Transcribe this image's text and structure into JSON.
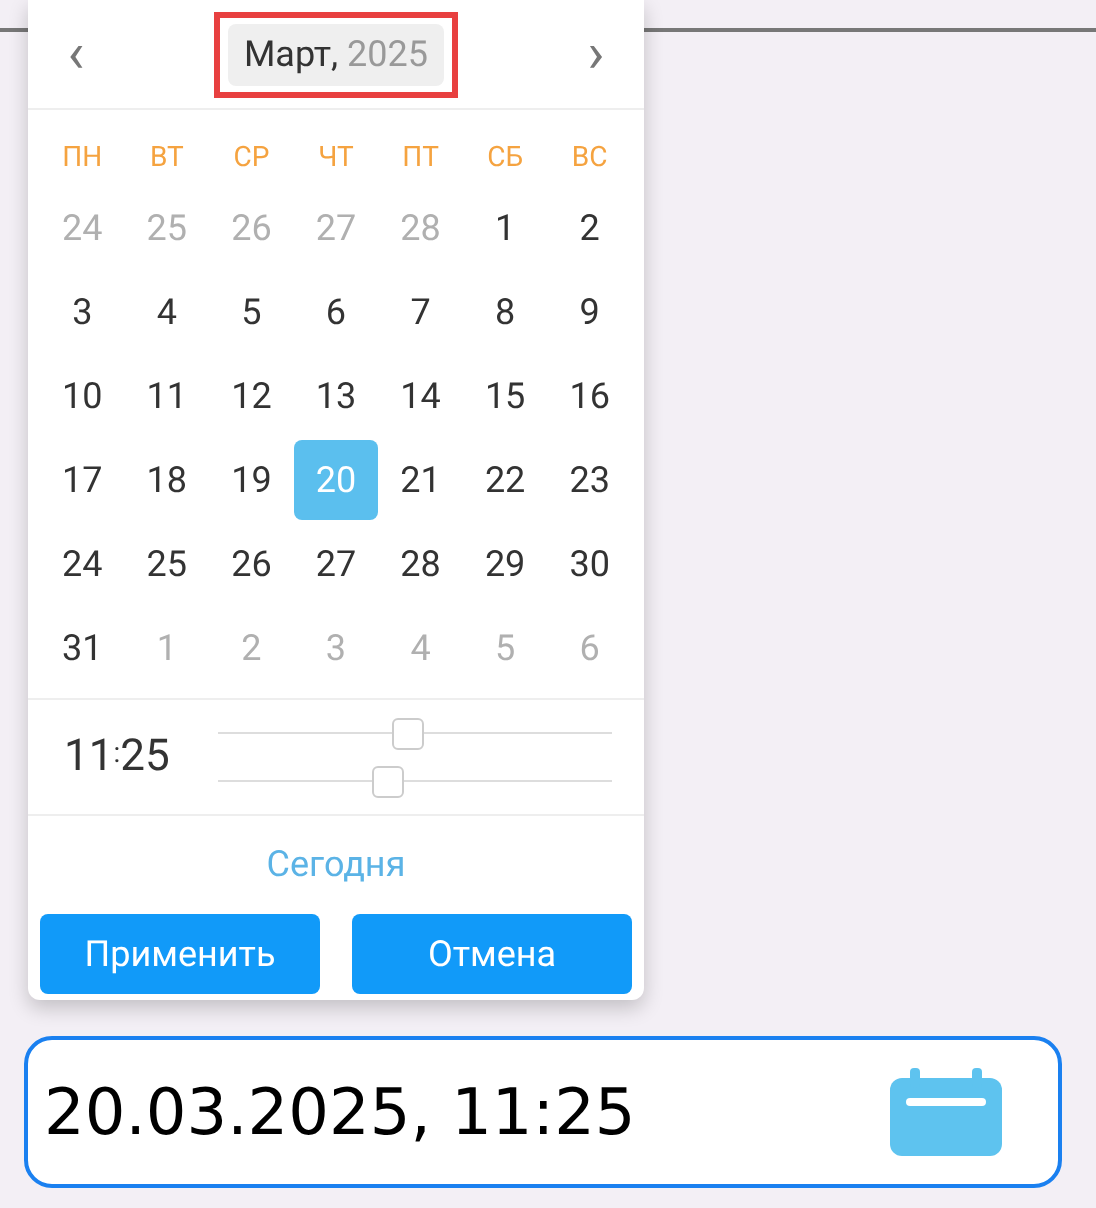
{
  "header": {
    "month": "Март,",
    "year": "2025",
    "highlighted": true,
    "prev": "‹",
    "next": "›"
  },
  "weekdays": [
    "ПН",
    "ВТ",
    "СР",
    "ЧТ",
    "ПТ",
    "СБ",
    "ВС"
  ],
  "weeks": [
    [
      {
        "day": "24",
        "muted": true,
        "selected": false
      },
      {
        "day": "25",
        "muted": true,
        "selected": false
      },
      {
        "day": "26",
        "muted": true,
        "selected": false
      },
      {
        "day": "27",
        "muted": true,
        "selected": false
      },
      {
        "day": "28",
        "muted": true,
        "selected": false
      },
      {
        "day": "1",
        "muted": false,
        "selected": false
      },
      {
        "day": "2",
        "muted": false,
        "selected": false
      }
    ],
    [
      {
        "day": "3",
        "muted": false,
        "selected": false
      },
      {
        "day": "4",
        "muted": false,
        "selected": false
      },
      {
        "day": "5",
        "muted": false,
        "selected": false
      },
      {
        "day": "6",
        "muted": false,
        "selected": false
      },
      {
        "day": "7",
        "muted": false,
        "selected": false
      },
      {
        "day": "8",
        "muted": false,
        "selected": false
      },
      {
        "day": "9",
        "muted": false,
        "selected": false
      }
    ],
    [
      {
        "day": "10",
        "muted": false,
        "selected": false
      },
      {
        "day": "11",
        "muted": false,
        "selected": false
      },
      {
        "day": "12",
        "muted": false,
        "selected": false
      },
      {
        "day": "13",
        "muted": false,
        "selected": false
      },
      {
        "day": "14",
        "muted": false,
        "selected": false
      },
      {
        "day": "15",
        "muted": false,
        "selected": false
      },
      {
        "day": "16",
        "muted": false,
        "selected": false
      }
    ],
    [
      {
        "day": "17",
        "muted": false,
        "selected": false
      },
      {
        "day": "18",
        "muted": false,
        "selected": false
      },
      {
        "day": "19",
        "muted": false,
        "selected": false
      },
      {
        "day": "20",
        "muted": false,
        "selected": true
      },
      {
        "day": "21",
        "muted": false,
        "selected": false
      },
      {
        "day": "22",
        "muted": false,
        "selected": false
      },
      {
        "day": "23",
        "muted": false,
        "selected": false
      }
    ],
    [
      {
        "day": "24",
        "muted": false,
        "selected": false
      },
      {
        "day": "25",
        "muted": false,
        "selected": false
      },
      {
        "day": "26",
        "muted": false,
        "selected": false
      },
      {
        "day": "27",
        "muted": false,
        "selected": false
      },
      {
        "day": "28",
        "muted": false,
        "selected": false
      },
      {
        "day": "29",
        "muted": false,
        "selected": false
      },
      {
        "day": "30",
        "muted": false,
        "selected": false
      }
    ],
    [
      {
        "day": "31",
        "muted": false,
        "selected": false
      },
      {
        "day": "1",
        "muted": true,
        "selected": false
      },
      {
        "day": "2",
        "muted": true,
        "selected": false
      },
      {
        "day": "3",
        "muted": true,
        "selected": false
      },
      {
        "day": "4",
        "muted": true,
        "selected": false
      },
      {
        "day": "5",
        "muted": true,
        "selected": false
      },
      {
        "day": "6",
        "muted": true,
        "selected": false
      }
    ]
  ],
  "time": {
    "hours": "11",
    "separator": ":",
    "minutes": "25",
    "sliders": [
      {
        "level": 0.48
      },
      {
        "level": 0.43
      }
    ]
  },
  "today": "Сегодня",
  "buttons": [
    "Применить",
    "Отмена"
  ],
  "input": {
    "value": "20.03.2025, 11:25"
  }
}
